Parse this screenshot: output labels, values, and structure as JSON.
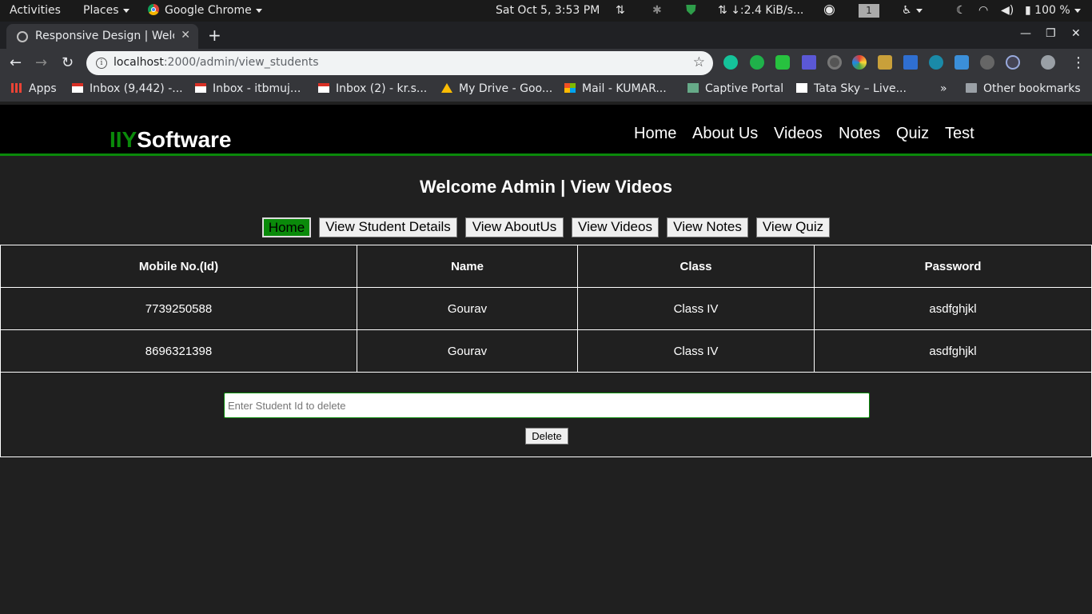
{
  "topbar": {
    "activities": "Activities",
    "places": "Places",
    "app": "Google Chrome",
    "datetime": "Sat Oct  5,  3:53 PM",
    "net_speed": "↓:2.4 KiB/s...",
    "workspace": "1",
    "battery": "100 %"
  },
  "tab": {
    "title": "Responsive Design | Welc"
  },
  "toolbar": {
    "url_host": "localhost",
    "url_path": ":2000/admin/view_students"
  },
  "bookmarks": [
    {
      "label": "Apps",
      "icon": "apps-icon"
    },
    {
      "label": "Inbox (9,442) -...",
      "icon": "gmail-icon"
    },
    {
      "label": "Inbox - itbmuj...",
      "icon": "gmail-icon"
    },
    {
      "label": "Inbox (2) - kr.s...",
      "icon": "gmail-icon"
    },
    {
      "label": "My Drive - Goo...",
      "icon": "drive-icon"
    },
    {
      "label": "Mail - KUMAR...",
      "icon": "microsoft-icon"
    },
    {
      "label": "Captive Portal",
      "icon": "portal-icon"
    },
    {
      "label": "Tata Sky – Live...",
      "icon": "tatasky-icon"
    }
  ],
  "other_bookmarks": "Other bookmarks",
  "site": {
    "logo_accent": "IIY",
    "logo_text": "Software",
    "nav": [
      "Home",
      "About Us",
      "Videos",
      "Notes",
      "Quiz",
      "Test"
    ],
    "heading": "Welcome Admin | View Videos",
    "admin_buttons": [
      "Home",
      "View Student Details",
      "View AboutUs",
      "View Videos",
      "View Notes",
      "View Quiz"
    ],
    "table": {
      "headers": [
        "Mobile No.(Id)",
        "Name",
        "Class",
        "Password"
      ],
      "rows": [
        [
          "7739250588",
          "Gourav",
          "Class IV",
          "asdfghjkl"
        ],
        [
          "8696321398",
          "Gourav",
          "Class IV",
          "asdfghjkl"
        ]
      ]
    },
    "delete_placeholder": "Enter Student Id to delete",
    "delete_label": "Delete"
  },
  "colors": {
    "accent": "#0a8a0a",
    "page_bg": "#202020",
    "header_bg": "#000000"
  }
}
